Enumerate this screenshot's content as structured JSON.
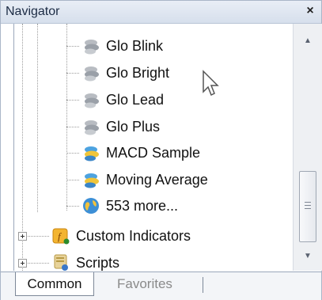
{
  "panel": {
    "title": "Navigator",
    "close_glyph": "×"
  },
  "tree": {
    "items": [
      {
        "label": "Glo Blink",
        "icon": "gray-indicator-icon"
      },
      {
        "label": "Glo Bright",
        "icon": "gray-indicator-icon"
      },
      {
        "label": "Glo Lead",
        "icon": "gray-indicator-icon"
      },
      {
        "label": "Glo Plus",
        "icon": "gray-indicator-icon"
      },
      {
        "label": "MACD Sample",
        "icon": "blue-yellow-indicator-icon"
      },
      {
        "label": "Moving Average",
        "icon": "blue-yellow-indicator-icon"
      },
      {
        "label": "553 more...",
        "icon": "globe-icon"
      }
    ],
    "folders": [
      {
        "label": "Custom Indicators",
        "icon": "custom-indicators-icon"
      },
      {
        "label": "Scripts",
        "icon": "scripts-icon"
      }
    ]
  },
  "tabs": [
    {
      "label": "Common",
      "active": true
    },
    {
      "label": "Favorites",
      "active": false
    }
  ],
  "colors": {
    "header_bg": "#dfe6f0",
    "border": "#9aa7bb",
    "text": "#111111",
    "inactive_tab": "#8a8a8a"
  }
}
